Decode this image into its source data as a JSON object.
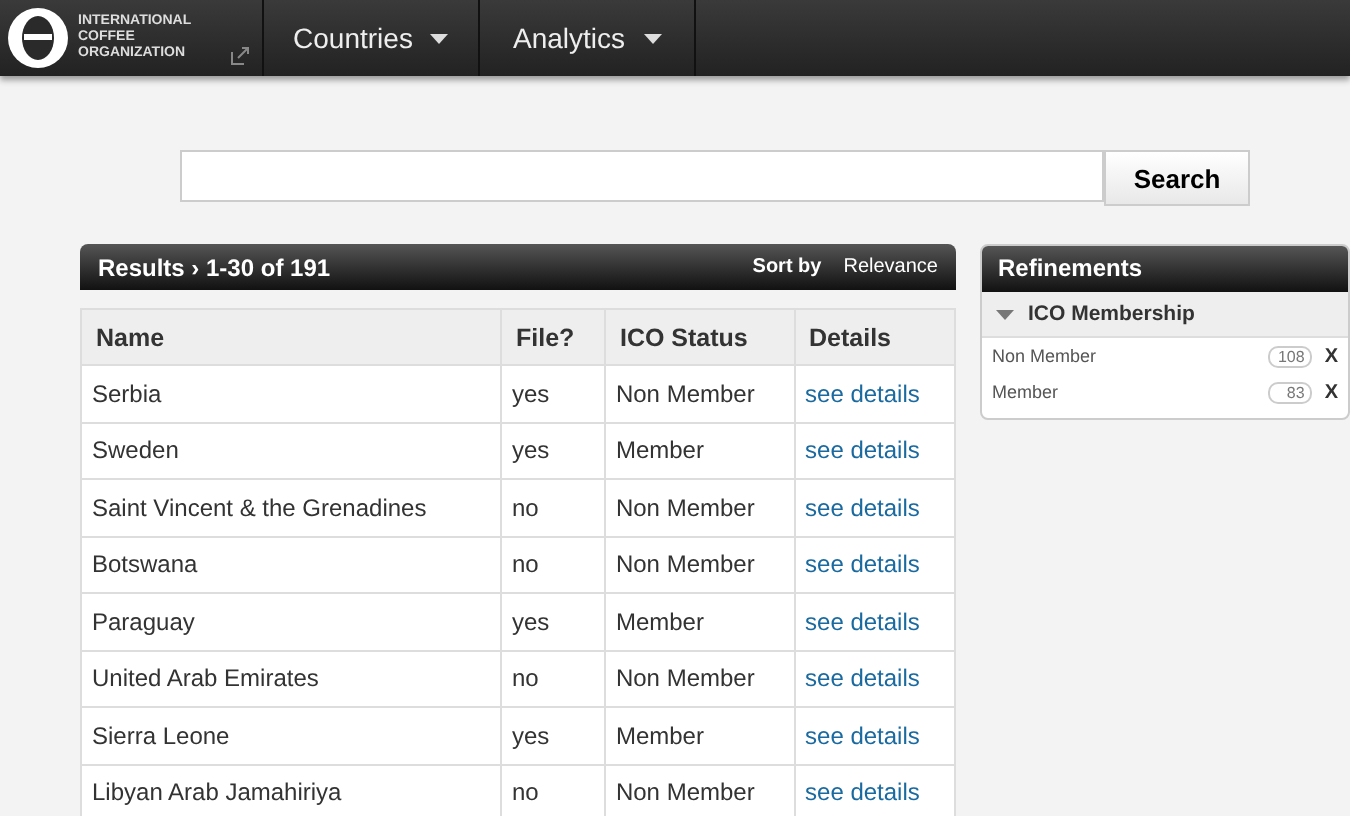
{
  "logo": {
    "lines": [
      "INTERNATIONAL",
      "COFFEE",
      "ORGANIZATION"
    ]
  },
  "nav": [
    {
      "label": "Countries"
    },
    {
      "label": "Analytics"
    }
  ],
  "search": {
    "button": "Search"
  },
  "results": {
    "title": "Results › 1-30 of 191",
    "sort_label": "Sort by",
    "sort_value": "Relevance"
  },
  "table": {
    "columns": [
      "Name",
      "File?",
      "ICO Status",
      "Details"
    ],
    "rows": [
      [
        "Serbia",
        "yes",
        "Non Member",
        "see details"
      ],
      [
        "Sweden",
        "yes",
        "Member",
        "see details"
      ],
      [
        "Saint Vincent & the Grenadines",
        "no",
        "Non Member",
        "see details"
      ],
      [
        "Botswana",
        "no",
        "Non Member",
        "see details"
      ],
      [
        "Paraguay",
        "yes",
        "Member",
        "see details"
      ],
      [
        "United Arab Emirates",
        "no",
        "Non Member",
        "see details"
      ],
      [
        "Sierra Leone",
        "yes",
        "Member",
        "see details"
      ],
      [
        "Libyan Arab Jamahiriya",
        "no",
        "Non Member",
        "see details"
      ]
    ]
  },
  "refinements": {
    "title": "Refinements",
    "group": "ICO Membership",
    "items": [
      {
        "label": "Non Member",
        "count": "108",
        "remove": "X"
      },
      {
        "label": "Member",
        "count": "83",
        "remove": "X"
      }
    ]
  }
}
